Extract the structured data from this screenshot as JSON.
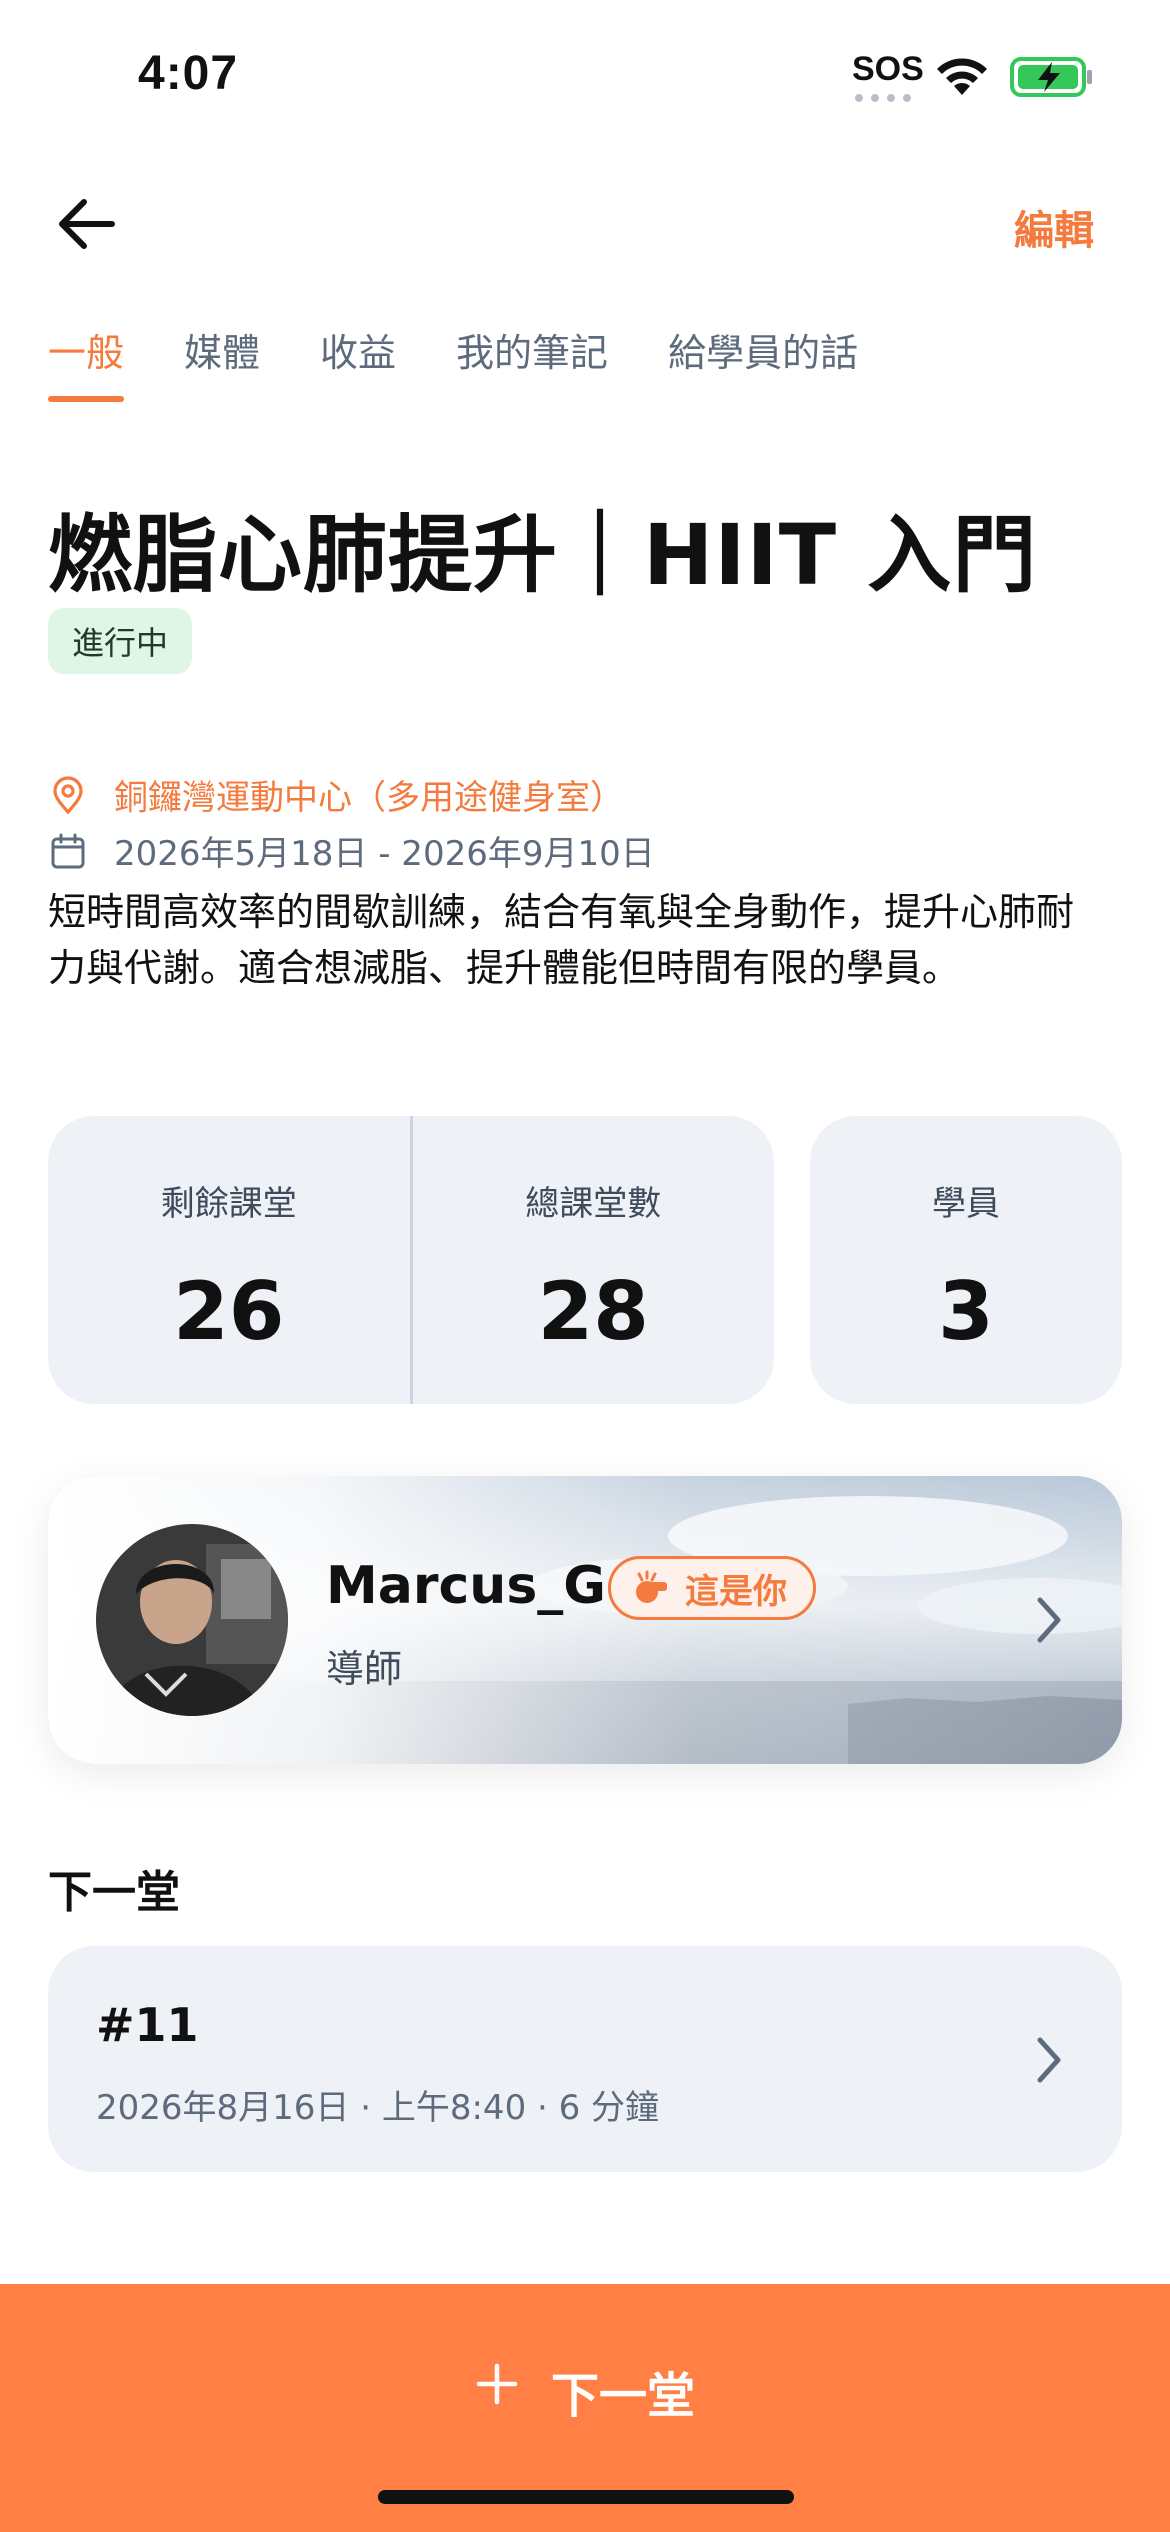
{
  "status_bar": {
    "time": "4:07",
    "sos": "SOS",
    "icons": [
      "wifi-icon",
      "battery-charging-icon"
    ],
    "battery_color": "#34c759"
  },
  "nav": {
    "back_icon": "arrow-left-icon",
    "edit_label": "編輯"
  },
  "tabs": [
    {
      "label": "一般",
      "active": true
    },
    {
      "label": "媒體",
      "active": false
    },
    {
      "label": "收益",
      "active": false
    },
    {
      "label": "我的筆記",
      "active": false
    },
    {
      "label": "給學員的話",
      "active": false
    }
  ],
  "course": {
    "title": "燃脂心肺提升｜HIIT 入門",
    "status": "進行中",
    "location": "銅鑼灣運動中心（多用途健身室）",
    "dates": "2026年5月18日 - 2026年9月10日",
    "description": "短時間高效率的間歇訓練，結合有氧與全身動作，提升心肺耐力與代謝。適合想減脂、提升體能但時間有限的學員。"
  },
  "stats": {
    "remaining_label": "剩餘課堂",
    "remaining_value": "26",
    "total_label": "總課堂數",
    "total_value": "28",
    "students_label": "學員",
    "students_value": "3"
  },
  "instructor": {
    "name": "Marcus_G",
    "badge": "這是你",
    "role": "導師"
  },
  "next_lesson": {
    "section_title": "下一堂",
    "number": "#11",
    "meta": "2026年8月16日 · 上午8:40 · 6 分鐘"
  },
  "bottom_button": {
    "label": "下一堂"
  },
  "colors": {
    "accent": "#f47a3e",
    "button": "#ff7f45",
    "card_bg": "#eef1f6",
    "badge_bg": "#dff5e6"
  }
}
